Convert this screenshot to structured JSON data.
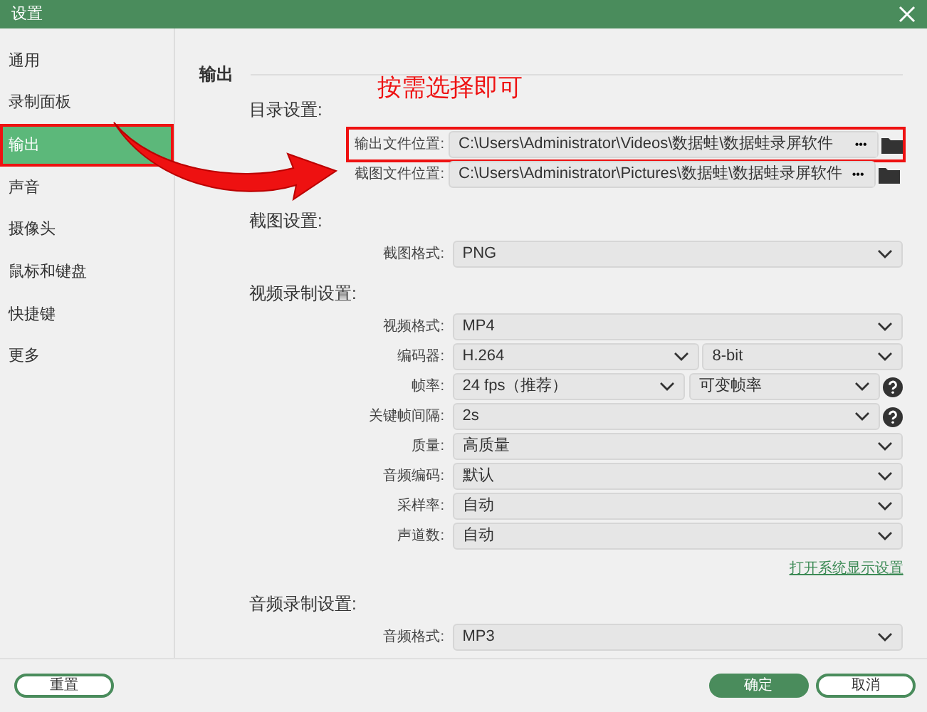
{
  "window": {
    "title": "设置"
  },
  "sidebar": {
    "items": [
      {
        "label": "通用",
        "selected": false,
        "highlighted": false
      },
      {
        "label": "录制面板",
        "selected": false,
        "highlighted": false
      },
      {
        "label": "输出",
        "selected": true,
        "highlighted": true
      },
      {
        "label": "声音",
        "selected": false,
        "highlighted": false
      },
      {
        "label": "摄像头",
        "selected": false,
        "highlighted": false
      },
      {
        "label": "鼠标和键盘",
        "selected": false,
        "highlighted": false
      },
      {
        "label": "快捷键",
        "selected": false,
        "highlighted": false
      },
      {
        "label": "更多",
        "selected": false,
        "highlighted": false
      }
    ]
  },
  "annotation": {
    "callout": "按需选择即可"
  },
  "output": {
    "heading": "输出",
    "directory_heading": "目录设置:",
    "paths": [
      {
        "label": "输出文件位置:",
        "value": "C:\\Users\\Administrator\\Videos\\数据蛙\\数据蛙录屏软件",
        "browse": "•••",
        "highlighted": true
      },
      {
        "label": "截图文件位置:",
        "value": "C:\\Users\\Administrator\\Pictures\\数据蛙\\数据蛙录屏软件",
        "browse": "•••",
        "highlighted": false
      }
    ]
  },
  "sections": [
    {
      "heading": "截图设置:",
      "fields": [
        {
          "label": "截图格式:",
          "selects": [
            "PNG"
          ],
          "help": false
        }
      ]
    },
    {
      "heading": "视频录制设置:",
      "fields": [
        {
          "label": "视频格式:",
          "selects": [
            "MP4"
          ],
          "help": false
        },
        {
          "label": "编码器:",
          "selects": [
            "H.264",
            "8-bit"
          ],
          "help": false
        },
        {
          "label": "帧率:",
          "selects": [
            "24 fps（推荐）",
            "可变帧率"
          ],
          "help": true
        },
        {
          "label": "关键帧间隔:",
          "selects": [
            "2s"
          ],
          "help": true
        },
        {
          "label": "质量:",
          "selects": [
            "高质量"
          ],
          "help": false
        },
        {
          "label": "音频编码:",
          "selects": [
            "默认"
          ],
          "help": false
        },
        {
          "label": "采样率:",
          "selects": [
            "自动"
          ],
          "help": false
        },
        {
          "label": "声道数:",
          "selects": [
            "自动"
          ],
          "help": false
        }
      ],
      "link": "打开系统显示设置"
    },
    {
      "heading": "音频录制设置:",
      "fields": [
        {
          "label": "音频格式:",
          "selects": [
            "MP3"
          ],
          "help": false
        }
      ]
    }
  ],
  "footer": {
    "buttons": [
      {
        "label": "重置",
        "kind": "outline"
      },
      {
        "label": "确定",
        "kind": "primary"
      },
      {
        "label": "取消",
        "kind": "outline"
      }
    ]
  }
}
